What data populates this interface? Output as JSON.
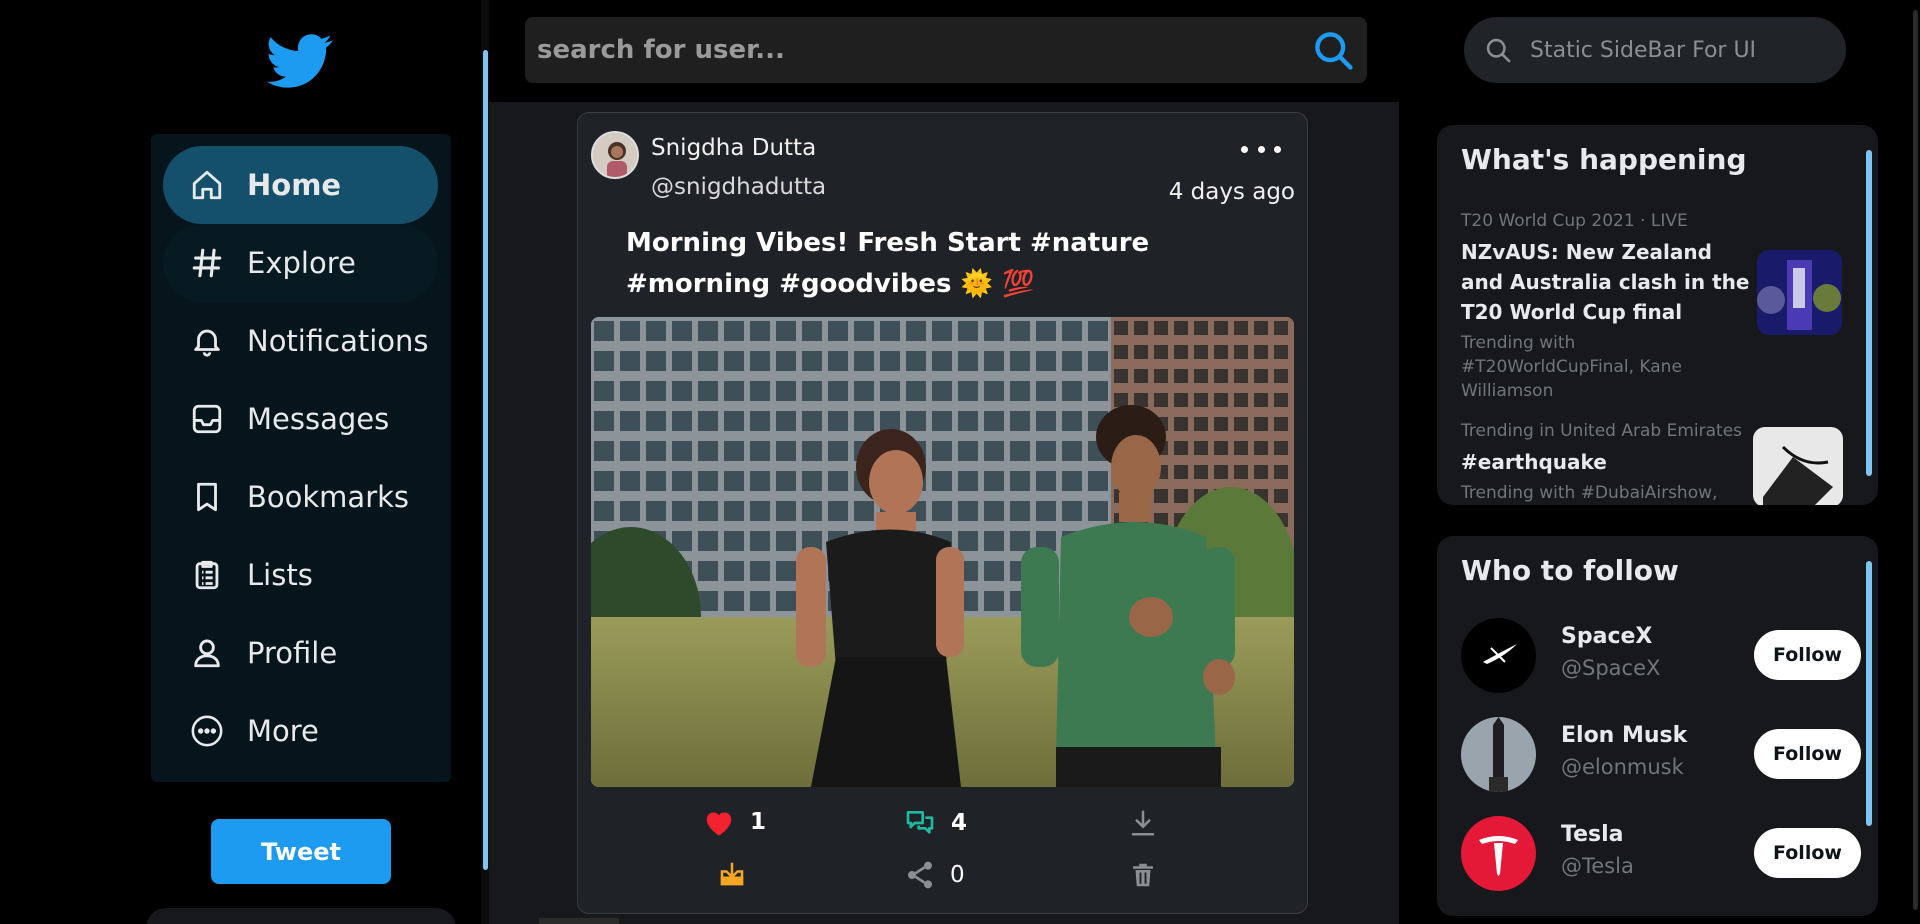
{
  "nav": {
    "items": [
      {
        "label": "Home",
        "icon": "home-icon",
        "active": true
      },
      {
        "label": "Explore",
        "icon": "hashtag-icon"
      },
      {
        "label": "Notifications",
        "icon": "bell-icon"
      },
      {
        "label": "Messages",
        "icon": "inbox-icon"
      },
      {
        "label": "Bookmarks",
        "icon": "bookmark-icon"
      },
      {
        "label": "Lists",
        "icon": "clipboard-list-icon"
      },
      {
        "label": "Profile",
        "icon": "person-icon"
      },
      {
        "label": "More",
        "icon": "more-circle-icon"
      }
    ],
    "tweet_button": "Tweet"
  },
  "search": {
    "placeholder": "search for user..."
  },
  "post": {
    "author_name": "Snigdha Dutta",
    "author_handle": "@snigdhadutta",
    "time": "4 days ago",
    "text": "Morning Vibes! Fresh Start #nature #morning #goodvibes 🌞 💯",
    "likes": "1",
    "comments": "4",
    "shares": "0"
  },
  "right": {
    "search_placeholder": "Static SideBar For UI",
    "happening_title": "What's happening",
    "trends": [
      {
        "meta": "T20 World Cup 2021 · LIVE",
        "title": "NZvAUS: New Zealand and Australia clash in the T20 World Cup final",
        "sub": "Trending with #T20WorldCupFinal, Kane Williamson"
      },
      {
        "meta": "Trending in United Arab Emirates",
        "title": "#earthquake",
        "sub": "Trending with #DubaiAirshow,"
      }
    ],
    "who_title": "Who to follow",
    "follow": [
      {
        "name": "SpaceX",
        "handle": "@SpaceX",
        "button": "Follow"
      },
      {
        "name": "Elon Musk",
        "handle": "@elonmusk",
        "button": "Follow"
      },
      {
        "name": "Tesla",
        "handle": "@Tesla",
        "button": "Follow"
      }
    ]
  },
  "colors": {
    "accent": "#1d9bf0",
    "like": "#f91880",
    "comment": "#1dbaa0",
    "save": "#f5a623"
  }
}
